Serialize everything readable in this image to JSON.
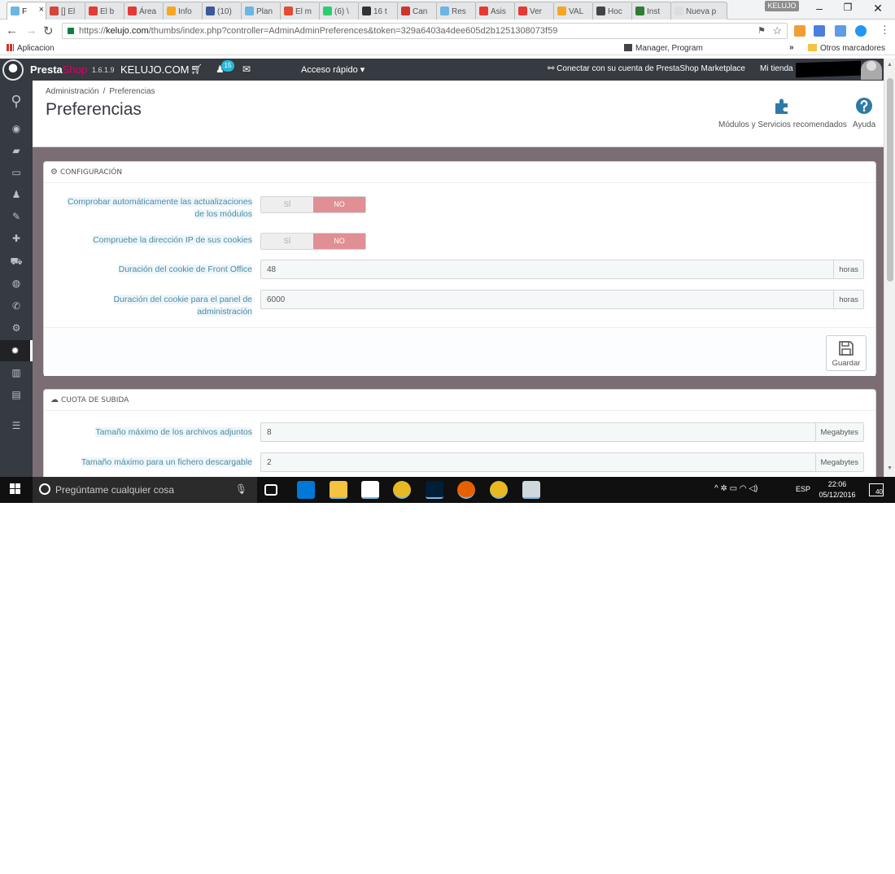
{
  "browser": {
    "tabs": [
      {
        "label": "F",
        "active": true,
        "color": "#6bb6e2"
      },
      {
        "label": "[] El",
        "color": "#d44638"
      },
      {
        "label": "El b",
        "color": "#e53935"
      },
      {
        "label": "Área",
        "color": "#e53935"
      },
      {
        "label": "Info",
        "color": "#f5a623"
      },
      {
        "label": "(10)",
        "color": "#3b5998"
      },
      {
        "label": "Plan",
        "color": "#6bb6e2"
      },
      {
        "label": "El m",
        "color": "#e24a33"
      },
      {
        "label": "(6) \\",
        "color": "#2ecc71"
      },
      {
        "label": "16 t",
        "color": "#333333"
      },
      {
        "label": "Can",
        "color": "#d0352b"
      },
      {
        "label": "Res",
        "color": "#6bb6e2"
      },
      {
        "label": "Asis",
        "color": "#e53935"
      },
      {
        "label": "Ver",
        "color": "#e53935"
      },
      {
        "label": "VAL",
        "color": "#f5a623"
      },
      {
        "label": "Hoc",
        "color": "#444444"
      },
      {
        "label": "Inst",
        "color": "#2e7d32"
      },
      {
        "label": "Nueva p",
        "color": "#dddddd"
      }
    ],
    "user_badge": "KELUJO",
    "url_prefix": "https://",
    "url_domain": "kelujo.com",
    "url_path": "/thumbs/index.php?controller=AdminAdminPreferences&token=329a6403a4dee605d2b1251308073f59",
    "bookmarks": {
      "apps_label": "Aplicacion",
      "items": [
        {
          "label": "Manager, Program",
          "color": "#444444"
        }
      ],
      "overflow": "»",
      "others_label": "Otros marcadores"
    }
  },
  "ps_header": {
    "logo_main": "Presta",
    "logo_accent": "Shop",
    "version": "1.6.1.9",
    "shop_name": "KELUJO.COM",
    "notification_count": "15",
    "quick_access": "Acceso rápido ▾",
    "marketplace_link": "Conectar con su cuenta de PrestaShop Marketplace",
    "my_store": "Mi tienda",
    "colors": {
      "bar": "#363a41",
      "accent": "#df0067",
      "badge": "#25b9d7"
    }
  },
  "sidebar": {
    "items": [
      {
        "name": "search",
        "glyph": "⚲"
      },
      {
        "name": "dashboard",
        "glyph": "◉"
      },
      {
        "name": "catalog",
        "glyph": "▰"
      },
      {
        "name": "orders",
        "glyph": "▭"
      },
      {
        "name": "customers",
        "glyph": "♟"
      },
      {
        "name": "price-rules",
        "glyph": "✎"
      },
      {
        "name": "modules",
        "glyph": "✚"
      },
      {
        "name": "shipping",
        "glyph": "⛟"
      },
      {
        "name": "localization",
        "glyph": "◍"
      },
      {
        "name": "preferences",
        "glyph": "✆"
      },
      {
        "name": "advanced-parameters",
        "glyph": "⚙"
      },
      {
        "name": "administration",
        "glyph": "✹",
        "active": true
      },
      {
        "name": "stats",
        "glyph": "▥"
      },
      {
        "name": "stock",
        "glyph": "▤"
      },
      {
        "name": "collapse-menu",
        "glyph": "☰"
      }
    ]
  },
  "page": {
    "breadcrumb": [
      "Administración",
      "Preferencias"
    ],
    "breadcrumb_sep": "/",
    "title": "Preferencias",
    "toolbar": {
      "modules_label": "Módulos y Servicios recomendados",
      "help_label": "Ayuda"
    }
  },
  "config_panel": {
    "heading": "CONFIGURACIÓN",
    "fields": [
      {
        "label_line1": "Comprobar automáticamente las actualizaciones",
        "label_line2": "de los módulos",
        "type": "switch",
        "yes": "SÍ",
        "no": "NO",
        "value": "NO"
      },
      {
        "label_line1": "Compruebe la dirección IP de sus cookies",
        "label_line2": "",
        "type": "switch",
        "yes": "SÍ",
        "no": "NO",
        "value": "NO"
      },
      {
        "label_line1": "Duración del cookie de Front Office",
        "label_line2": "",
        "type": "input",
        "value": "48",
        "unit": "horas"
      },
      {
        "label_line1": "Duración del cookie para el panel de",
        "label_line2": "administración",
        "type": "input",
        "value": "6000",
        "unit": "horas"
      }
    ],
    "save_label": "Guardar"
  },
  "upload_panel": {
    "heading": "CUOTA DE SUBIDA",
    "fields": [
      {
        "label": "Tamaño máximo de los archivos adjuntos",
        "value": "8",
        "unit": "Megabytes"
      },
      {
        "label": "Tamaño máximo para un fichero descargable",
        "value": "2",
        "unit": "Megabytes"
      }
    ]
  },
  "taskbar": {
    "search_placeholder": "Pregúntame cualquier cosa",
    "apps": [
      {
        "name": "task-view",
        "color": "#101010"
      },
      {
        "name": "edge",
        "color": "#0078d7"
      },
      {
        "name": "file-explorer",
        "color": "#f5c242"
      },
      {
        "name": "store",
        "color": "#ffffff"
      },
      {
        "name": "chrome",
        "color": "#e8b923"
      },
      {
        "name": "photoshop",
        "color": "#001e36"
      },
      {
        "name": "firefox",
        "color": "#e66000"
      },
      {
        "name": "chrome-active",
        "color": "#e8b923"
      },
      {
        "name": "paint",
        "color": "#cfd8dc"
      }
    ],
    "tray_icons": "^ ✲ ▭ ◠ ◁)",
    "language": "ESP",
    "time": "22:06",
    "date": "05/12/2016",
    "notification_count": "40"
  }
}
